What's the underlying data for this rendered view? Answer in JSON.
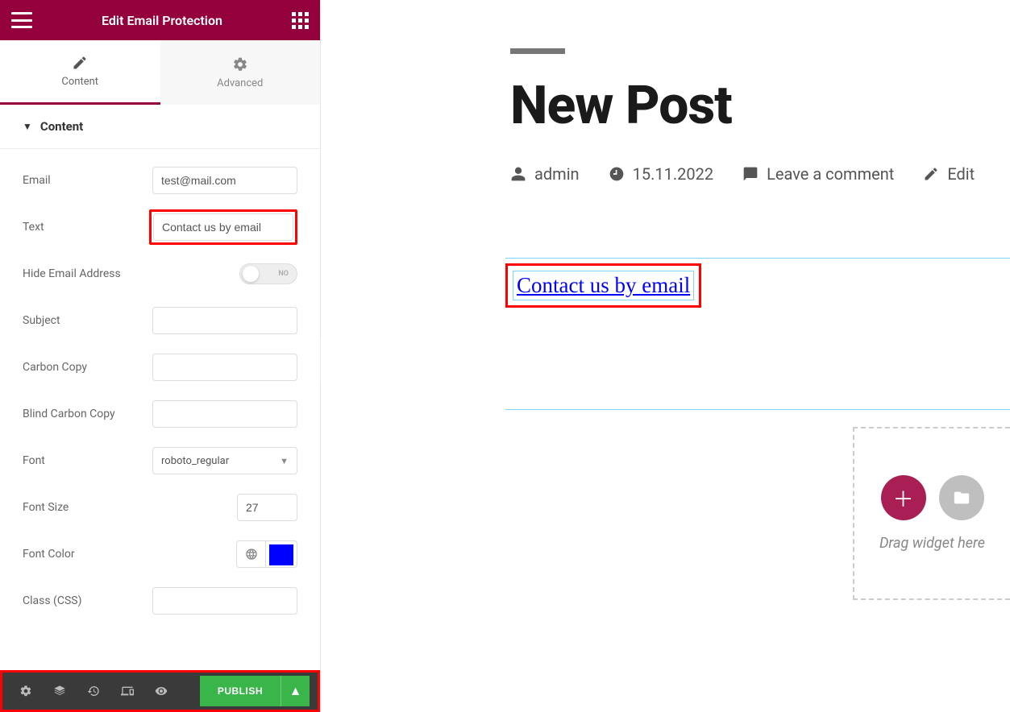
{
  "panel": {
    "title": "Edit Email Protection",
    "tabs": {
      "content": "Content",
      "advanced": "Advanced"
    },
    "section_title": "Content",
    "fields": {
      "email_label": "Email",
      "email_value": "test@mail.com",
      "text_label": "Text",
      "text_value": "Contact us by email",
      "hide_label": "Hide Email Address",
      "hide_state": "NO",
      "subject_label": "Subject",
      "subject_value": "",
      "cc_label": "Carbon Copy",
      "cc_value": "",
      "bcc_label": "Blind Carbon Copy",
      "bcc_value": "",
      "font_label": "Font",
      "font_value": "roboto_regular",
      "fontsize_label": "Font Size",
      "fontsize_value": "27",
      "fontcolor_label": "Font Color",
      "fontcolor_value": "#0000ff",
      "class_label": "Class (CSS)",
      "class_value": ""
    },
    "footer": {
      "publish": "PUBLISH"
    }
  },
  "preview": {
    "post_title": "New Post",
    "meta": {
      "author": "admin",
      "date": "15.11.2022",
      "comment": "Leave a comment",
      "edit": "Edit"
    },
    "email_link_text": "Contact us by email",
    "drop_label": "Drag widget here"
  }
}
